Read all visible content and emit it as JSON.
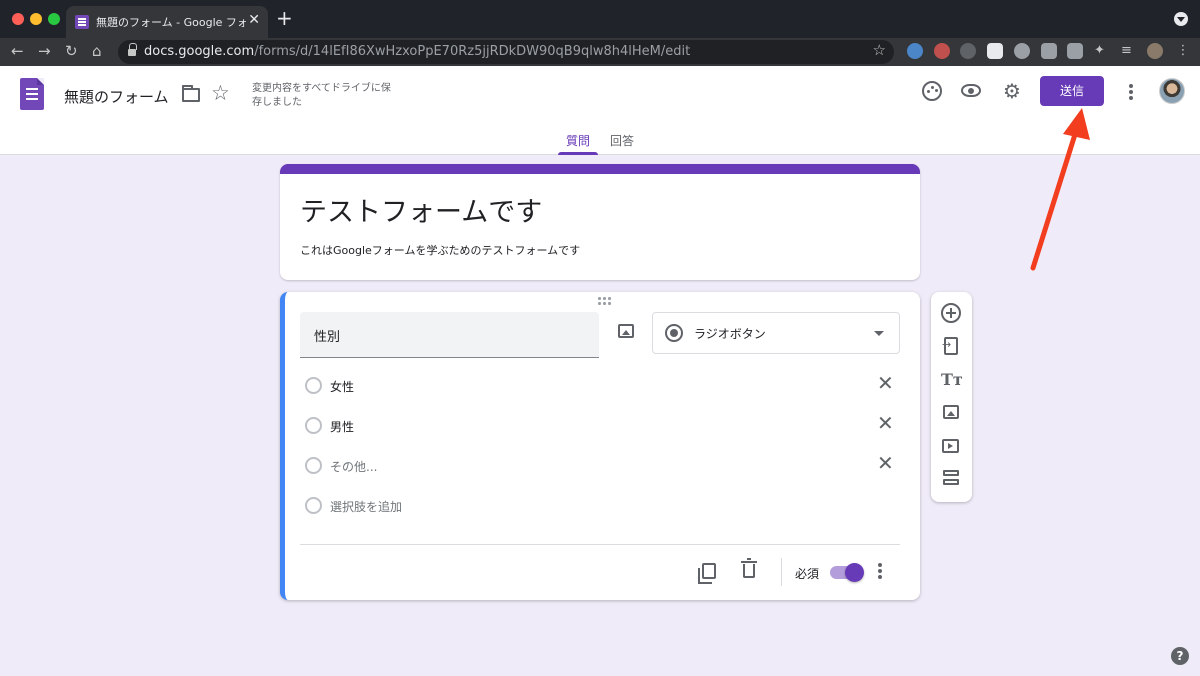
{
  "browser": {
    "tab_title": "無題のフォーム - Google フォーム",
    "url_host": "docs.google.com",
    "url_path": "/forms/d/14lEfI86XwHzxoPpE70Rz5jjRDkDW90qB9qlw8h4lHeM/edit",
    "traffic_colors": [
      "#ff5f57",
      "#febc2e",
      "#28c840"
    ],
    "extension_colors": [
      "#4a86c8",
      "#c0504d",
      "#5f6368",
      "#d9534f",
      "#9aa0a6",
      "#9aa0a6",
      "#9aa0a6",
      "#9aa0a6"
    ]
  },
  "header": {
    "title": "無題のフォーム",
    "save_status": "変更内容をすべてドライブに保存しました",
    "send_label": "送信",
    "accent_color": "#673ab7"
  },
  "tabs": {
    "questions": "質問",
    "responses": "回答"
  },
  "form": {
    "title": "テストフォームです",
    "description": "これはGoogleフォームを学ぶためのテストフォームです"
  },
  "question": {
    "title": "性別",
    "type_label": "ラジオボタン",
    "options": [
      {
        "label": "女性"
      },
      {
        "label": "男性"
      },
      {
        "label": "その他..."
      }
    ],
    "add_option_label": "選択肢を追加",
    "required_label": "必須",
    "required": true
  },
  "side_toolbar": {
    "icons": [
      "add-question-icon",
      "import-questions-icon",
      "add-title-icon",
      "add-image-icon",
      "add-video-icon",
      "add-section-icon"
    ]
  },
  "annotation": {
    "arrow_color": "#f23d1f"
  }
}
